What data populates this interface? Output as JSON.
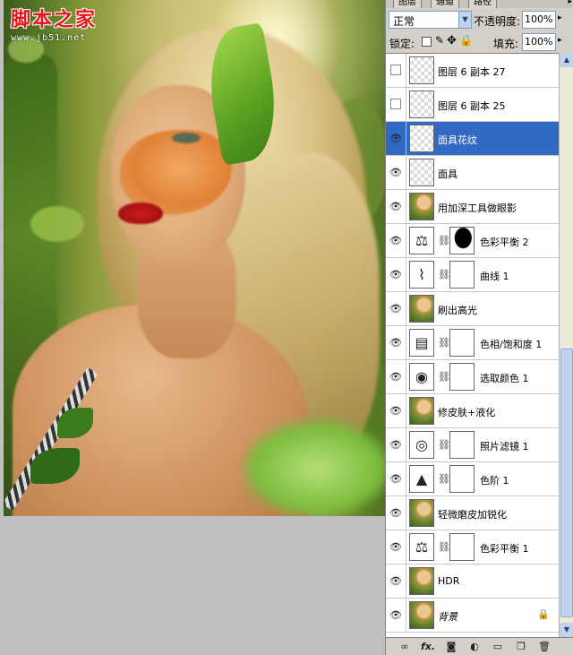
{
  "watermark": {
    "title": "脚本之家",
    "url": "www.jb51.net"
  },
  "panel_tabs": [
    "图层",
    "通道",
    "路径"
  ],
  "blend": {
    "mode": "正常",
    "opacity_label": "不透明度:",
    "opacity_value": "100%"
  },
  "lock": {
    "label": "锁定:",
    "fill_label": "填充:",
    "fill_value": "100%"
  },
  "layers": [
    {
      "name": "图层 6 副本 27",
      "visible": false,
      "thumb": "checker"
    },
    {
      "name": "图层 6 副本 25",
      "visible": false,
      "thumb": "checker"
    },
    {
      "name": "面具花纹",
      "visible": true,
      "thumb": "checker",
      "selected": true
    },
    {
      "name": "面具",
      "visible": true,
      "thumb": "checker"
    },
    {
      "name": "用加深工具做眼影",
      "visible": true,
      "thumb": "photo"
    },
    {
      "name": "色彩平衡 2",
      "visible": true,
      "thumb": "adjust",
      "icon": "balance-icon",
      "mask": true
    },
    {
      "name": "曲线 1",
      "visible": true,
      "thumb": "adjust",
      "icon": "curves-icon",
      "mask": true
    },
    {
      "name": "刷出高光",
      "visible": true,
      "thumb": "photo"
    },
    {
      "name": "色相/饱和度 1",
      "visible": true,
      "thumb": "adjust",
      "icon": "hue-saturation-icon",
      "mask": true
    },
    {
      "name": "选取颜色 1",
      "visible": true,
      "thumb": "adjust",
      "icon": "selective-color-icon",
      "mask": true
    },
    {
      "name": "修皮肤+液化",
      "visible": true,
      "thumb": "photo"
    },
    {
      "name": "照片滤镜 1",
      "visible": true,
      "thumb": "adjust",
      "icon": "photo-filter-icon",
      "mask": true
    },
    {
      "name": "色阶 1",
      "visible": true,
      "thumb": "adjust",
      "icon": "levels-icon",
      "mask": true
    },
    {
      "name": "轻微磨皮加锐化",
      "visible": true,
      "thumb": "photo"
    },
    {
      "name": "色彩平衡 1",
      "visible": true,
      "thumb": "adjust",
      "icon": "balance-icon",
      "mask": true
    },
    {
      "name": "HDR",
      "visible": true,
      "thumb": "photo"
    },
    {
      "name": "背景",
      "visible": true,
      "thumb": "photo",
      "italic": true,
      "locked": true
    }
  ],
  "icons": {
    "visibility": "eye-icon",
    "link": "chain-icon",
    "lock": "lock-icon",
    "bottom": [
      "link-layers-icon",
      "fx-icon",
      "mask-icon",
      "adjustment-icon",
      "folder-icon",
      "new-layer-icon",
      "trash-icon"
    ]
  },
  "colors": {
    "selection": "#316ac5",
    "panel": "#d4d0c8",
    "workspace": "#c0c0c0"
  }
}
